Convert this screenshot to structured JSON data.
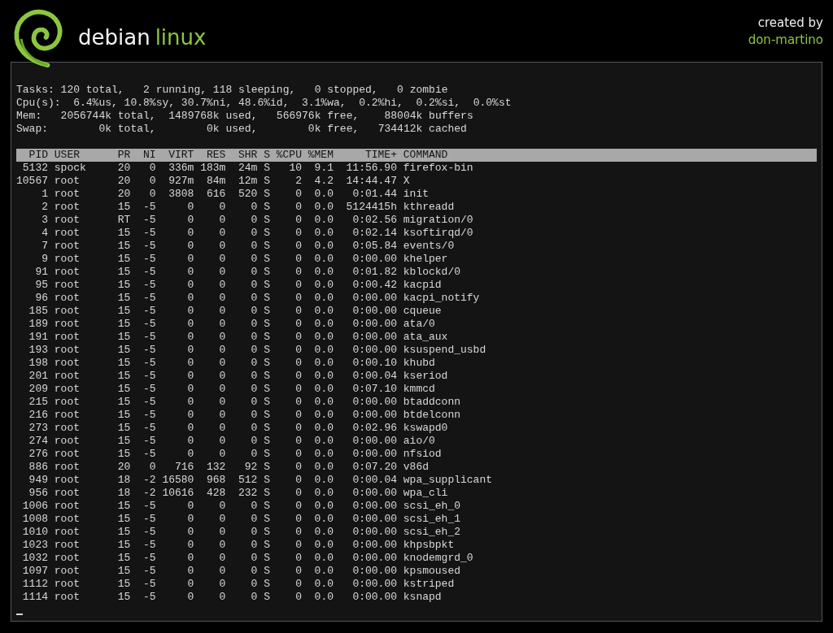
{
  "brand": {
    "name": "debian",
    "accent": "linux"
  },
  "credit": {
    "label": "created by",
    "author": "don-martino"
  },
  "terminal": {
    "summary_lines": [
      "Tasks: 120 total,   2 running, 118 sleeping,   0 stopped,   0 zombie",
      "Cpu(s):  6.4%us, 10.8%sy, 30.7%ni, 48.6%id,  3.1%wa,  0.2%hi,  0.2%si,  0.0%st",
      "Mem:   2056744k total,  1489768k used,   566976k free,    88004k buffers",
      "Swap:        0k total,        0k used,        0k free,   734412k cached"
    ],
    "columns": [
      "PID",
      "USER",
      "PR",
      "NI",
      "VIRT",
      "RES",
      "SHR",
      "S",
      "%CPU",
      "%MEM",
      "TIME+",
      "COMMAND"
    ],
    "rows": [
      [
        "5132",
        "spock",
        "20",
        "0",
        "336m",
        "183m",
        "24m",
        "S",
        "10",
        "9.1",
        "11:56.90",
        "firefox-bin"
      ],
      [
        "10567",
        "root",
        "20",
        "0",
        "927m",
        "84m",
        "12m",
        "S",
        "2",
        "4.2",
        "14:44.47",
        "X"
      ],
      [
        "1",
        "root",
        "20",
        "0",
        "3808",
        "616",
        "520",
        "S",
        "0",
        "0.0",
        "0:01.44",
        "init"
      ],
      [
        "2",
        "root",
        "15",
        "-5",
        "0",
        "0",
        "0",
        "S",
        "0",
        "0.0",
        "5124415h",
        "kthreadd"
      ],
      [
        "3",
        "root",
        "RT",
        "-5",
        "0",
        "0",
        "0",
        "S",
        "0",
        "0.0",
        "0:02.56",
        "migration/0"
      ],
      [
        "4",
        "root",
        "15",
        "-5",
        "0",
        "0",
        "0",
        "S",
        "0",
        "0.0",
        "0:02.14",
        "ksoftirqd/0"
      ],
      [
        "7",
        "root",
        "15",
        "-5",
        "0",
        "0",
        "0",
        "S",
        "0",
        "0.0",
        "0:05.84",
        "events/0"
      ],
      [
        "9",
        "root",
        "15",
        "-5",
        "0",
        "0",
        "0",
        "S",
        "0",
        "0.0",
        "0:00.00",
        "khelper"
      ],
      [
        "91",
        "root",
        "15",
        "-5",
        "0",
        "0",
        "0",
        "S",
        "0",
        "0.0",
        "0:01.82",
        "kblockd/0"
      ],
      [
        "95",
        "root",
        "15",
        "-5",
        "0",
        "0",
        "0",
        "S",
        "0",
        "0.0",
        "0:00.42",
        "kacpid"
      ],
      [
        "96",
        "root",
        "15",
        "-5",
        "0",
        "0",
        "0",
        "S",
        "0",
        "0.0",
        "0:00.00",
        "kacpi_notify"
      ],
      [
        "185",
        "root",
        "15",
        "-5",
        "0",
        "0",
        "0",
        "S",
        "0",
        "0.0",
        "0:00.00",
        "cqueue"
      ],
      [
        "189",
        "root",
        "15",
        "-5",
        "0",
        "0",
        "0",
        "S",
        "0",
        "0.0",
        "0:00.00",
        "ata/0"
      ],
      [
        "191",
        "root",
        "15",
        "-5",
        "0",
        "0",
        "0",
        "S",
        "0",
        "0.0",
        "0:00.00",
        "ata_aux"
      ],
      [
        "193",
        "root",
        "15",
        "-5",
        "0",
        "0",
        "0",
        "S",
        "0",
        "0.0",
        "0:00.00",
        "ksuspend_usbd"
      ],
      [
        "198",
        "root",
        "15",
        "-5",
        "0",
        "0",
        "0",
        "S",
        "0",
        "0.0",
        "0:00.10",
        "khubd"
      ],
      [
        "201",
        "root",
        "15",
        "-5",
        "0",
        "0",
        "0",
        "S",
        "0",
        "0.0",
        "0:00.04",
        "kseriod"
      ],
      [
        "209",
        "root",
        "15",
        "-5",
        "0",
        "0",
        "0",
        "S",
        "0",
        "0.0",
        "0:07.10",
        "kmmcd"
      ],
      [
        "215",
        "root",
        "15",
        "-5",
        "0",
        "0",
        "0",
        "S",
        "0",
        "0.0",
        "0:00.00",
        "btaddconn"
      ],
      [
        "216",
        "root",
        "15",
        "-5",
        "0",
        "0",
        "0",
        "S",
        "0",
        "0.0",
        "0:00.00",
        "btdelconn"
      ],
      [
        "273",
        "root",
        "15",
        "-5",
        "0",
        "0",
        "0",
        "S",
        "0",
        "0.0",
        "0:02.96",
        "kswapd0"
      ],
      [
        "274",
        "root",
        "15",
        "-5",
        "0",
        "0",
        "0",
        "S",
        "0",
        "0.0",
        "0:00.00",
        "aio/0"
      ],
      [
        "276",
        "root",
        "15",
        "-5",
        "0",
        "0",
        "0",
        "S",
        "0",
        "0.0",
        "0:00.00",
        "nfsiod"
      ],
      [
        "886",
        "root",
        "20",
        "0",
        "716",
        "132",
        "92",
        "S",
        "0",
        "0.0",
        "0:07.20",
        "v86d"
      ],
      [
        "949",
        "root",
        "18",
        "-2",
        "16580",
        "968",
        "512",
        "S",
        "0",
        "0.0",
        "0:00.04",
        "wpa_supplicant"
      ],
      [
        "956",
        "root",
        "18",
        "-2",
        "10616",
        "428",
        "232",
        "S",
        "0",
        "0.0",
        "0:00.00",
        "wpa_cli"
      ],
      [
        "1006",
        "root",
        "15",
        "-5",
        "0",
        "0",
        "0",
        "S",
        "0",
        "0.0",
        "0:00.00",
        "scsi_eh_0"
      ],
      [
        "1008",
        "root",
        "15",
        "-5",
        "0",
        "0",
        "0",
        "S",
        "0",
        "0.0",
        "0:00.00",
        "scsi_eh_1"
      ],
      [
        "1010",
        "root",
        "15",
        "-5",
        "0",
        "0",
        "0",
        "S",
        "0",
        "0.0",
        "0:00.00",
        "scsi_eh_2"
      ],
      [
        "1023",
        "root",
        "15",
        "-5",
        "0",
        "0",
        "0",
        "S",
        "0",
        "0.0",
        "0:00.00",
        "khpsbpkt"
      ],
      [
        "1032",
        "root",
        "15",
        "-5",
        "0",
        "0",
        "0",
        "S",
        "0",
        "0.0",
        "0:00.00",
        "knodemgrd_0"
      ],
      [
        "1097",
        "root",
        "15",
        "-5",
        "0",
        "0",
        "0",
        "S",
        "0",
        "0.0",
        "0:00.00",
        "kpsmoused"
      ],
      [
        "1112",
        "root",
        "15",
        "-5",
        "0",
        "0",
        "0",
        "S",
        "0",
        "0.0",
        "0:00.00",
        "kstriped"
      ],
      [
        "1114",
        "root",
        "15",
        "-5",
        "0",
        "0",
        "0",
        "S",
        "0",
        "0.0",
        "0:00.00",
        "ksnapd"
      ]
    ]
  }
}
